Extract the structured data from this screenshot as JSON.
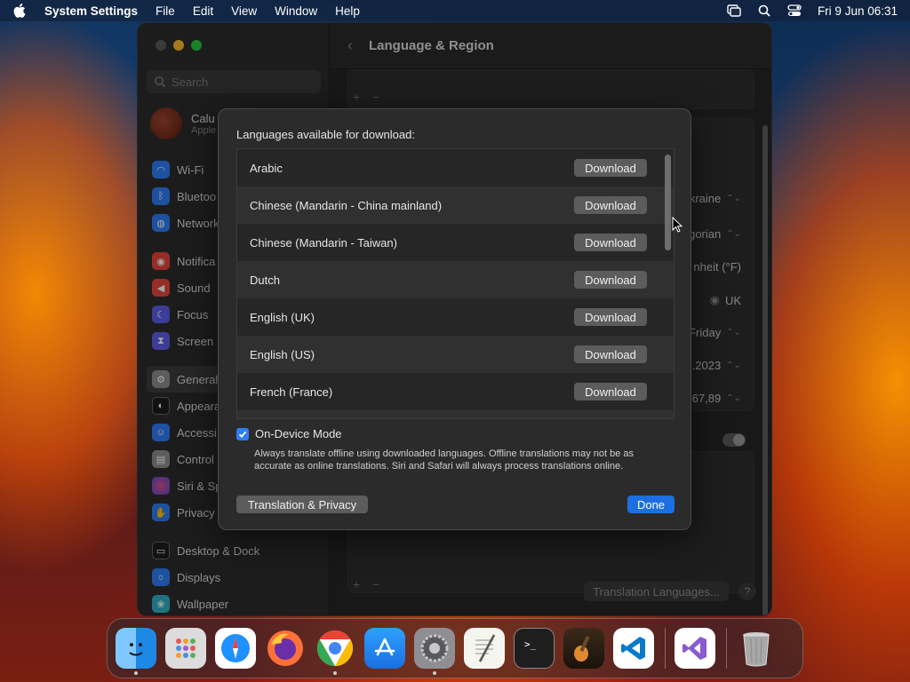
{
  "menubar": {
    "app_name": "System Settings",
    "items": [
      "File",
      "Edit",
      "View",
      "Window",
      "Help"
    ],
    "datetime": "Fri 9 Jun  06:31"
  },
  "window": {
    "title": "Language & Region",
    "search_placeholder": "Search",
    "account": {
      "name": "Calu",
      "sub": "Apple"
    },
    "sidebar": [
      {
        "label": "Wi-Fi",
        "color": "#2f7df6",
        "icon": "wifi-icon"
      },
      {
        "label": "Bluetoo",
        "color": "#2f7df6",
        "icon": "bluetooth-icon"
      },
      {
        "label": "Network",
        "color": "#2f7df6",
        "icon": "globe-icon"
      },
      {
        "label": "Notifica",
        "color": "#e8453c",
        "icon": "bell-icon"
      },
      {
        "label": "Sound",
        "color": "#e8453c",
        "icon": "speaker-icon"
      },
      {
        "label": "Focus",
        "color": "#5e5ce6",
        "icon": "moon-icon"
      },
      {
        "label": "Screen",
        "color": "#5e5ce6",
        "icon": "hourglass-icon"
      },
      {
        "label": "General",
        "color": "#8e8e93",
        "icon": "gear-icon"
      },
      {
        "label": "Appeara",
        "color": "#1c1c1e",
        "icon": "appearance-icon"
      },
      {
        "label": "Accessi",
        "color": "#2f7df6",
        "icon": "accessibility-icon"
      },
      {
        "label": "Control",
        "color": "#8e8e93",
        "icon": "control-center-icon"
      },
      {
        "label": "Siri & Sp",
        "color": "#b14bd1",
        "icon": "siri-icon"
      },
      {
        "label": "Privacy",
        "color": "#2f7df6",
        "icon": "hand-icon"
      },
      {
        "label": "Desktop & Dock",
        "color": "#1c1c1e",
        "icon": "dock-icon"
      },
      {
        "label": "Displays",
        "color": "#2f7df6",
        "icon": "display-icon"
      },
      {
        "label": "Wallpaper",
        "color": "#30b0c7",
        "icon": "wallpaper-icon"
      }
    ],
    "background_values": {
      "region": "kraine",
      "calendar": "gorian",
      "temperature": "nheit (°F)",
      "measurement_us": "S",
      "measurement_uk": "UK",
      "first_day": "Friday",
      "date_format": "3.2023",
      "number_format": "567,89"
    },
    "translation_languages_button": "Translation Languages...",
    "help": "?"
  },
  "sheet": {
    "title": "Languages available for download:",
    "languages": [
      {
        "name": "Arabic",
        "action": "Download"
      },
      {
        "name": "Chinese (Mandarin - China mainland)",
        "action": "Download"
      },
      {
        "name": "Chinese (Mandarin - Taiwan)",
        "action": "Download"
      },
      {
        "name": "Dutch",
        "action": "Download"
      },
      {
        "name": "English (UK)",
        "action": "Download"
      },
      {
        "name": "English (US)",
        "action": "Download"
      },
      {
        "name": "French (France)",
        "action": "Download"
      }
    ],
    "on_device_label": "On-Device Mode",
    "on_device_checked": true,
    "on_device_desc": "Always translate offline using downloaded languages. Offline translations may not be as accurate as online translations. Siri and Safari will always process translations online.",
    "translation_privacy": "Translation & Privacy",
    "done": "Done"
  },
  "dock": [
    {
      "name": "finder-icon",
      "running": true,
      "color": "#1e88e5"
    },
    {
      "name": "launchpad-icon",
      "running": false,
      "color": "#e0e0e0"
    },
    {
      "name": "safari-icon",
      "running": false,
      "color": "#1e90ff"
    },
    {
      "name": "firefox-icon",
      "running": false,
      "color": "#ff7139"
    },
    {
      "name": "chrome-icon",
      "running": true,
      "color": "#ffffff"
    },
    {
      "name": "app-store-icon",
      "running": false,
      "color": "#1a8cff"
    },
    {
      "name": "system-settings-icon",
      "running": true,
      "color": "#8e8e93"
    },
    {
      "name": "textedit-icon",
      "running": false,
      "color": "#f0f0f0"
    },
    {
      "name": "terminal-icon",
      "running": false,
      "color": "#1c1c1c"
    },
    {
      "name": "garageband-icon",
      "running": false,
      "color": "#3a2a1a"
    },
    {
      "name": "vscode-icon",
      "running": false,
      "color": "#ffffff"
    },
    {
      "name": "visual-studio-icon",
      "running": false,
      "color": "#ffffff"
    },
    {
      "name": "trash-icon",
      "running": false,
      "color": "#9a9a9a"
    }
  ]
}
